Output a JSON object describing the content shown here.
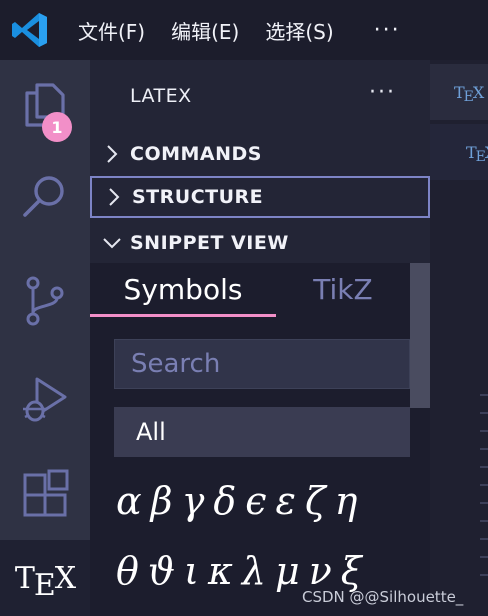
{
  "titlebar": {
    "menus": [
      "文件(F)",
      "编辑(E)",
      "选择(S)"
    ],
    "more": "···"
  },
  "activitybar": {
    "items": [
      {
        "name": "explorer",
        "icon": "files-icon",
        "badge": "1"
      },
      {
        "name": "search",
        "icon": "search-icon"
      },
      {
        "name": "source-control",
        "icon": "source-control-icon"
      },
      {
        "name": "run-debug",
        "icon": "run-debug-icon"
      },
      {
        "name": "extensions",
        "icon": "extensions-icon"
      },
      {
        "name": "tex",
        "icon": "tex-icon",
        "label_t": "T",
        "label_e": "E",
        "label_x": "X"
      }
    ]
  },
  "sidepanel": {
    "title": "LATEX",
    "more": "···",
    "sections": [
      {
        "label": "COMMANDS",
        "expanded": false
      },
      {
        "label": "STRUCTURE",
        "expanded": false
      },
      {
        "label": "SNIPPET VIEW",
        "expanded": true
      }
    ],
    "snippet": {
      "tabs": [
        "Symbols",
        "TikZ"
      ],
      "active_tab": "Symbols",
      "search_placeholder": "Search",
      "category": "All",
      "row1": [
        "α",
        "β",
        "γ",
        "δ",
        "ϵ",
        "ε",
        "ζ",
        "η"
      ],
      "row2": [
        "θ",
        "ϑ",
        "ι",
        "κ",
        "λ",
        "μ",
        "ν",
        "ξ"
      ]
    }
  },
  "editor": {
    "tab_t": "T",
    "tab_e": "E",
    "tab_x": "X"
  },
  "watermark": "CSDN @@Silhouette_",
  "colors": {
    "accent_pink": "#f28fc8",
    "focus_border": "#7d84c6",
    "icon_blue": "#7a7fb3",
    "vscode_blue": "#1a8fe0"
  }
}
